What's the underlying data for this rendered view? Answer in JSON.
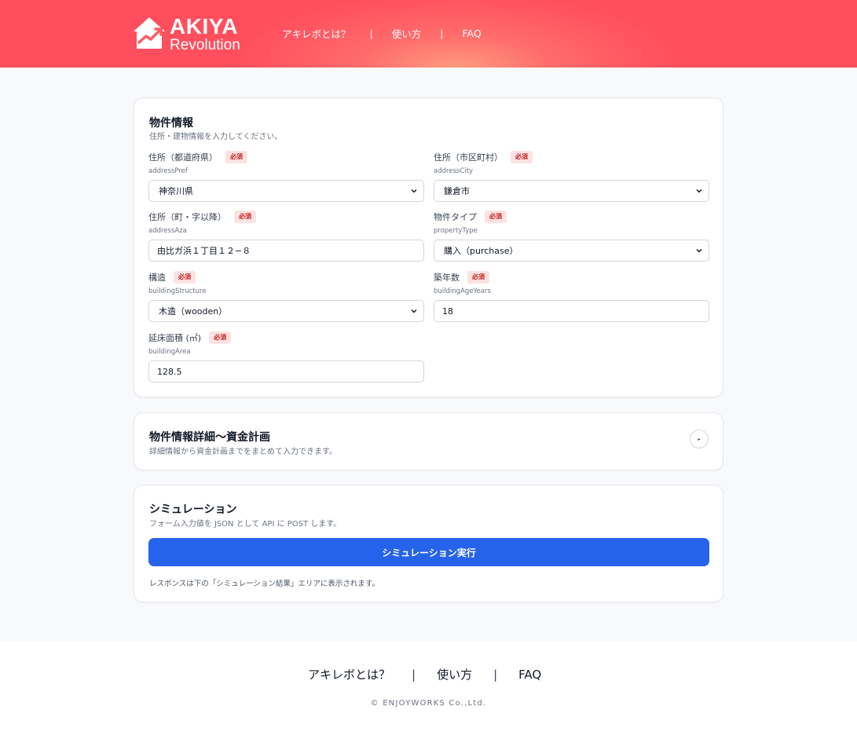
{
  "brand": {
    "line1": "AKIYA",
    "line2": "Revolution"
  },
  "nav": {
    "items": [
      "アキレボとは？",
      "使い方",
      "FAQ"
    ],
    "separator": "|"
  },
  "property_card": {
    "title": "物件情報",
    "subtitle": "住所・建物情報を入力してください。",
    "required_label": "必須",
    "fields": [
      {
        "label": "住所（都道府県）",
        "key": "addressPref",
        "type": "select",
        "value": "神奈川県"
      },
      {
        "label": "住所（市区町村）",
        "key": "addressCity",
        "type": "select",
        "value": "鎌倉市"
      },
      {
        "label": "住所（町・字以降）",
        "key": "addressAza",
        "type": "text",
        "value": "由比ガ浜１丁目１２−８"
      },
      {
        "label": "物件タイプ",
        "key": "propertyType",
        "type": "select",
        "value": "購入（purchase）"
      },
      {
        "label": "構造",
        "key": "buildingStructure",
        "type": "select",
        "value": "木造（wooden）"
      },
      {
        "label": "築年数",
        "key": "buildingAgeYears",
        "type": "text",
        "value": "18"
      },
      {
        "label": "延床面積 (㎡)",
        "key": "buildingArea",
        "type": "text",
        "value": "128.5"
      }
    ]
  },
  "detail_card": {
    "title": "物件情報詳細〜資金計画",
    "subtitle": "詳細情報から資金計画までをまとめて入力できます。",
    "toggle_icon": "▸"
  },
  "simulation_card": {
    "title": "シミュレーション",
    "subtitle": "フォーム入力値を JSON として API に POST します。",
    "button_label": "シミュレーション実行",
    "note": "レスポンスは下の「シミュレーション結果」エリアに表示されます。"
  },
  "footer": {
    "nav": [
      "アキレボとは？",
      "使い方",
      "FAQ"
    ],
    "separator": "|",
    "copyright": "© ENJOYWORKS Co.,Ltd."
  },
  "colors": {
    "header": "#ff5a63",
    "primary_button": "#2563eb",
    "required_bg": "#fde2e2",
    "required_text": "#c81e1e"
  }
}
